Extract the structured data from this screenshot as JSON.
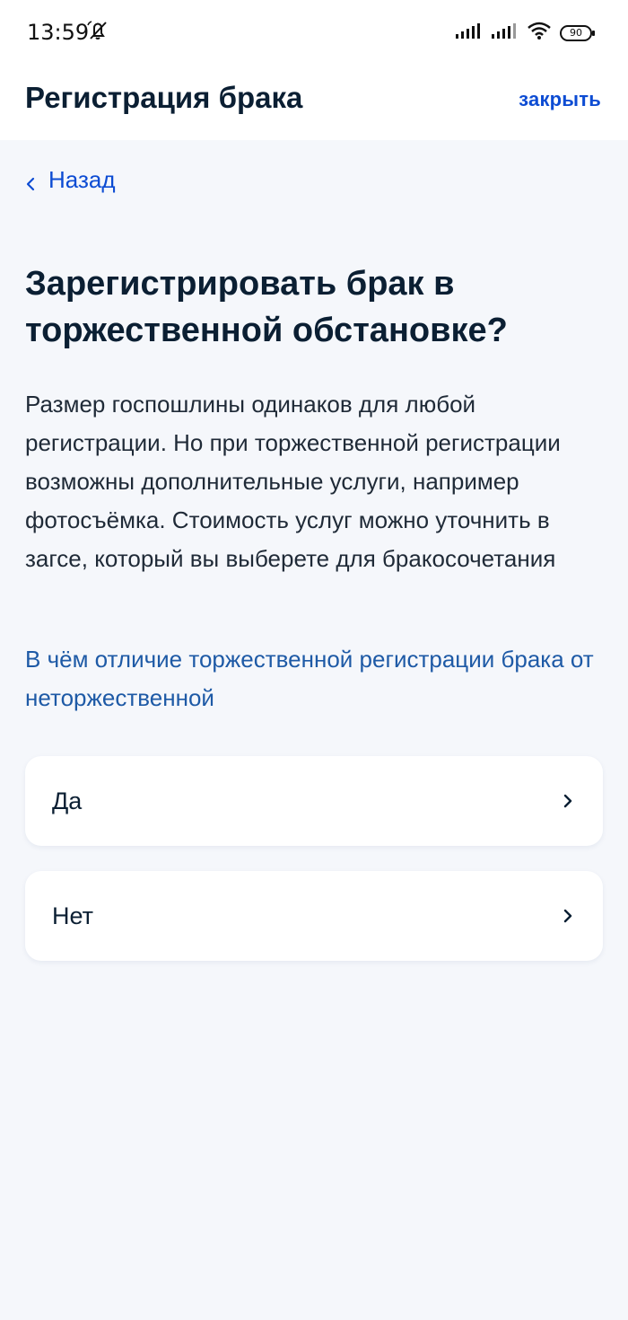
{
  "status_bar": {
    "time": "13:59",
    "battery": "90",
    "icons": [
      "notifications-muted-icon",
      "signal-icon",
      "signal-icon",
      "wifi-icon",
      "battery-icon"
    ]
  },
  "header": {
    "title": "Регистрация брака",
    "close_label": "закрыть"
  },
  "back": {
    "label": "Назад"
  },
  "main": {
    "question": "Зарегистрировать брак в торжественной обстановке?",
    "description": "Размер госпошлины одинаков для любой регистрации. Но при торжественной регистрации возможны дополнительные услуги, например фотосъёмка. Стоимость услуг можно уточнить в загсе, который вы выберете для бракосочетания",
    "link": "В чём отличие торжественной регистрации брака от неторжественной"
  },
  "options": [
    {
      "label": "Да"
    },
    {
      "label": "Нет"
    }
  ],
  "colors": {
    "accent": "#0d4cd3",
    "link": "#1e5aa6",
    "background": "#f5f7fb",
    "card": "#ffffff",
    "title": "#0b1f33"
  }
}
